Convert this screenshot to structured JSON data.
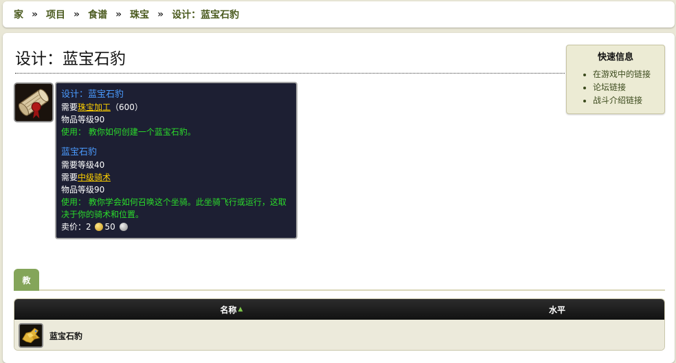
{
  "breadcrumb": {
    "items": [
      "家",
      "项目",
      "食谱",
      "珠宝",
      "设计：蓝宝石豹"
    ],
    "separator": "»"
  },
  "page": {
    "title": "设计：蓝宝石豹"
  },
  "quick_info": {
    "title": "快速信息",
    "links": [
      "在游戏中的链接",
      "论坛链接",
      "战斗介绍链接"
    ]
  },
  "tooltip": {
    "title": "设计：蓝宝石豹",
    "req_prefix": "需要",
    "req_skill": "珠宝加工",
    "req_skill_level": "（600）",
    "item_level": "物品等级90",
    "use_text": "使用： 教你如何创建一个蓝宝石豹。",
    "sub_title": "蓝宝石豹",
    "req_level": "需要等级40",
    "req2_prefix": "需要",
    "req2_skill": "中级骑术",
    "item_level2": "物品等级90",
    "use_text2": "使用： 教你学会如何召唤这个坐骑。此坐骑飞行或运行，这取决于你的骑术和位置。",
    "sell_label": "卖价：",
    "sell_gold": "2",
    "sell_silver": "50"
  },
  "tabs": [
    {
      "label": "教"
    }
  ],
  "table": {
    "headers": {
      "name": "名称",
      "level": "水平"
    },
    "rows": [
      {
        "name": "蓝宝石豹",
        "level": ""
      }
    ]
  },
  "colors": {
    "accent_green": "#84a55a",
    "tooltip_bg": "#1d1f33",
    "tooltip_title": "#4a9bff",
    "tooltip_green": "#2bdc2b",
    "tooltip_link": "#ffd100",
    "breadcrumb_text": "#4a5a1e"
  }
}
